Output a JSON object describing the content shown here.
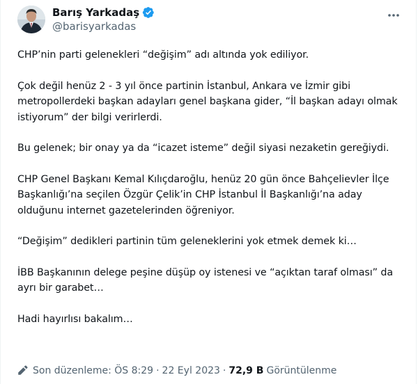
{
  "author": {
    "display_name": "Barış Yarkadaş",
    "handle": "@barisyarkadas"
  },
  "tweet": {
    "paragraphs": [
      "CHP’nin parti gelenekleri “değişim” adı altında yok ediliyor.",
      "Çok değil henüz 2 - 3 yıl önce partinin İstanbul, Ankara ve İzmir gibi metropollerdeki başkan adayları genel başkana gider, “İl başkan adayı olmak istiyorum” der bilgi verirlerdi.",
      "Bu gelenek; bir onay ya da “icazet isteme” değil siyasi nezaketin gereğiydi.",
      "CHP Genel Başkanı Kemal Kılıçdaroğlu, henüz 20 gün önce Bahçelievler İlçe Başkanlığı’na seçilen Özgür Çelik’in CHP İstanbul İl Başkanlığı’na aday olduğunu internet gazetelerinden öğreniyor.",
      "“Değişim” dedikleri partinin tüm geleneklerini yok etmek demek ki…",
      "İBB Başkanının delege peşine düşüp oy istenesi ve “açıktan taraf olması” da ayrı bir garabet…",
      "Hadi hayırlısı bakalım…"
    ]
  },
  "meta": {
    "edited_label": "Son düzenleme: ÖS 8:29",
    "separator_1": "·",
    "date": "22 Eyl 2023",
    "separator_2": "·",
    "views_count": "72,9 B",
    "views_label": "Görüntülenme"
  },
  "colors": {
    "text": "#0f1419",
    "secondary": "#536471",
    "verified": "#1d9bf0"
  },
  "icons": {
    "verified": "verified-badge-icon",
    "more": "more-options-icon",
    "edit": "edit-pencil-icon"
  }
}
